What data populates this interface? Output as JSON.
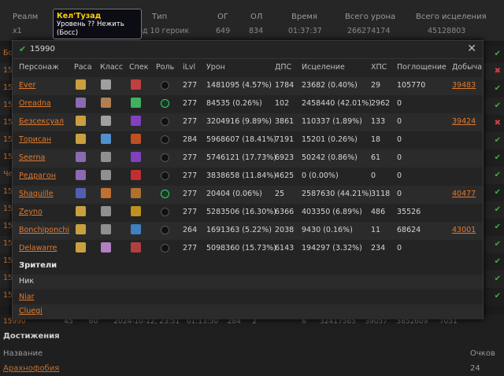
{
  "background": {
    "headers": [
      "Реалм",
      "Тип",
      "ОГ",
      "ОЛ",
      "Время",
      "Всего урона",
      "Всего исцеления"
    ],
    "values": [
      "x1",
      "Под 10 героик",
      "649",
      "834",
      "01:37:37",
      "266274174",
      "45128803"
    ],
    "row_links": [
      "Бо",
      "15",
      "15",
      "15",
      "15",
      "15",
      "15",
      "Че",
      "15",
      "15",
      "15",
      "15",
      "15",
      "15",
      "15"
    ],
    "peek_row": [
      "15990",
      "45",
      "60",
      "2024-10-12, 23:51",
      "01:13:50",
      "284",
      "2",
      "6",
      "32417565",
      "39057",
      "5852609",
      "7051"
    ],
    "achievements_title": "Достижения",
    "ach_col_name": "Название",
    "ach_col_points": "Очков",
    "ach_row_name": "Арахнофобия",
    "ach_row_points": "24"
  },
  "tooltip": {
    "title": "Кел'Тузад",
    "line1": "Уровень ?? Нежить",
    "line2": "(Босс)"
  },
  "modal": {
    "title": "15990",
    "columns": [
      "Персонаж",
      "Раса",
      "Класс",
      "Спек",
      "Роль",
      "iLvl",
      "Урон",
      "ДПС",
      "Исцеление",
      "ХПС",
      "Поглощение",
      "Добыча"
    ],
    "players": [
      {
        "name": "Ever",
        "ilvl": "277",
        "damage": "1481095 (4.57%)",
        "dps": "1784",
        "heal": "23682 (0.40%)",
        "hps": "29",
        "absorb": "105770",
        "loot": "39483"
      },
      {
        "name": "Oreadna",
        "ilvl": "277",
        "damage": "84535 (0.26%)",
        "dps": "102",
        "heal": "2458440 (42.01%)",
        "hps": "2962",
        "absorb": "0",
        "loot": ""
      },
      {
        "name": "Безсексуал",
        "ilvl": "277",
        "damage": "3204916 (9.89%)",
        "dps": "3861",
        "heal": "110337 (1.89%)",
        "hps": "133",
        "absorb": "0",
        "loot": "39424"
      },
      {
        "name": "Торисан",
        "ilvl": "284",
        "damage": "5968607 (18.41%)",
        "dps": "7191",
        "heal": "15201 (0.26%)",
        "hps": "18",
        "absorb": "0",
        "loot": ""
      },
      {
        "name": "Seerna",
        "ilvl": "277",
        "damage": "5746121 (17.73%)",
        "dps": "6923",
        "heal": "50242 (0.86%)",
        "hps": "61",
        "absorb": "0",
        "loot": ""
      },
      {
        "name": "Редрагон",
        "ilvl": "277",
        "damage": "3838658 (11.84%)",
        "dps": "4625",
        "heal": "0 (0.00%)",
        "hps": "0",
        "absorb": "0",
        "loot": ""
      },
      {
        "name": "Shaquille",
        "ilvl": "277",
        "damage": "20404 (0.06%)",
        "dps": "25",
        "heal": "2587630 (44.21%)",
        "hps": "3118",
        "absorb": "0",
        "loot": "40477"
      },
      {
        "name": "Zeyno",
        "ilvl": "277",
        "damage": "5283506 (16.30%)",
        "dps": "6366",
        "heal": "403350 (6.89%)",
        "hps": "486",
        "absorb": "35526",
        "loot": ""
      },
      {
        "name": "Bonchiponchi",
        "ilvl": "264",
        "damage": "1691363 (5.22%)",
        "dps": "2038",
        "heal": "9430 (0.16%)",
        "hps": "11",
        "absorb": "68624",
        "loot": "43001"
      },
      {
        "name": "Delawarre",
        "ilvl": "277",
        "damage": "5098360 (15.73%)",
        "dps": "6143",
        "heal": "194297 (3.32%)",
        "hps": "234",
        "absorb": "0",
        "loot": ""
      }
    ],
    "spectators_title": "Зрители",
    "spectators": [
      "Ник",
      "Niar",
      "Cluegi"
    ]
  }
}
